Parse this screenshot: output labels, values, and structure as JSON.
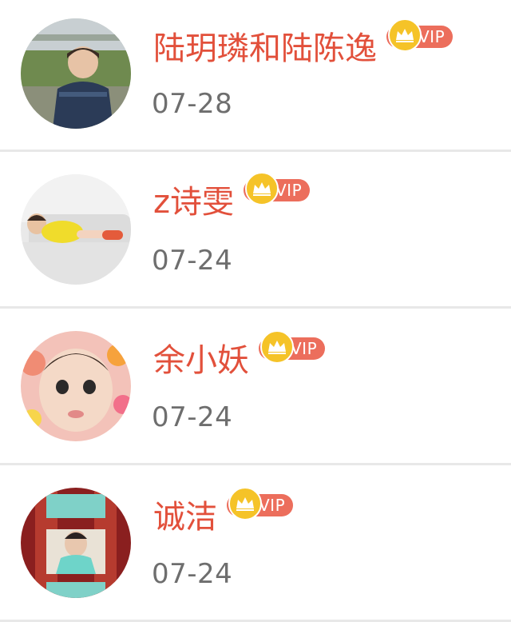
{
  "comments": [
    {
      "name": "陆玥璘和陆陈逸",
      "date": "07-28",
      "badge": "VIP"
    },
    {
      "name": "z诗雯",
      "date": "07-24",
      "badge": "VIP"
    },
    {
      "name": "余小妖",
      "date": "07-24",
      "badge": "VIP"
    },
    {
      "name": "诚洁",
      "date": "07-24",
      "badge": "VIP"
    }
  ],
  "colors": {
    "name": "#e2503b",
    "vip_pill": "#ec6e5c",
    "crown": "#f5c328",
    "date": "#6e6e6e",
    "divider": "#e8e8e8"
  },
  "icons": {
    "badge": "crown-icon"
  }
}
